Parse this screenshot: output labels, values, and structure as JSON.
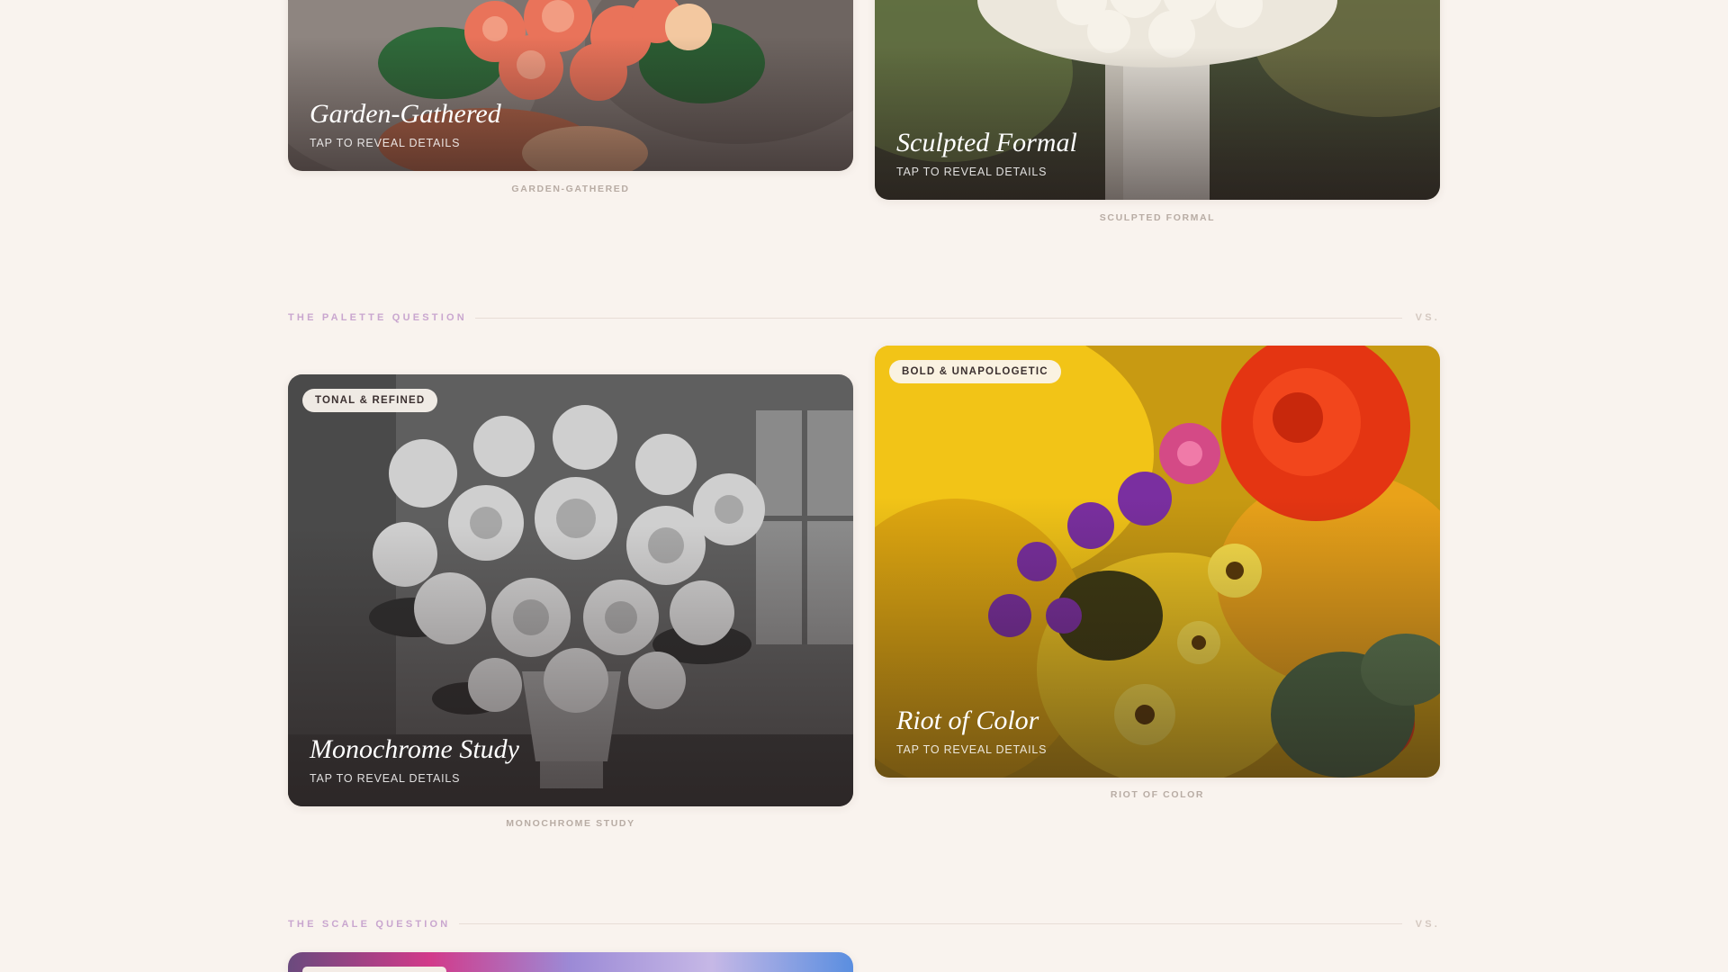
{
  "top_pair": {
    "left": {
      "title": "Garden-Gathered",
      "hint": "TAP TO REVEAL DETAILS",
      "caption": "GARDEN-GATHERED"
    },
    "right": {
      "title": "Sculpted Formal",
      "hint": "TAP TO REVEAL DETAILS",
      "caption": "SCULPTED FORMAL"
    }
  },
  "palette_section": {
    "label": "THE PALETTE QUESTION",
    "vs": "VS.",
    "left": {
      "badge": "TONAL & REFINED",
      "title": "Monochrome Study",
      "hint": "TAP TO REVEAL DETAILS",
      "caption": "MONOCHROME STUDY"
    },
    "right": {
      "badge": "BOLD & UNAPOLOGETIC",
      "title": "Riot of Color",
      "hint": "TAP TO REVEAL DETAILS",
      "caption": "RIOT OF COLOR"
    }
  },
  "scale_section": {
    "label": "THE SCALE QUESTION",
    "vs": "VS."
  },
  "colors": {
    "background": "#f9f3ee",
    "section_label": "#c9a6cf",
    "caption": "#b8aca4"
  }
}
